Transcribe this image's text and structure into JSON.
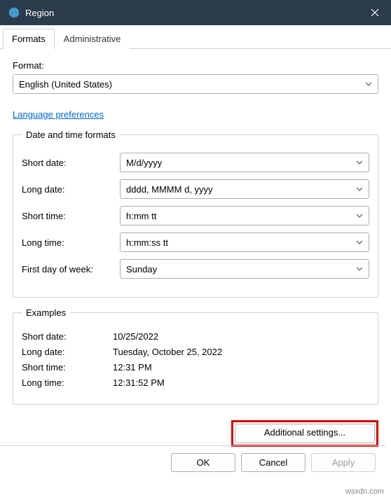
{
  "titlebar": {
    "title": "Region"
  },
  "tabs": {
    "formats": "Formats",
    "administrative": "Administrative"
  },
  "format": {
    "label": "Format:",
    "value": "English (United States)"
  },
  "link": {
    "language_prefs": "Language preferences"
  },
  "datetime_formats": {
    "legend": "Date and time formats",
    "short_date": {
      "label": "Short date:",
      "value": "M/d/yyyy"
    },
    "long_date": {
      "label": "Long date:",
      "value": "dddd, MMMM d, yyyy"
    },
    "short_time": {
      "label": "Short time:",
      "value": "h:mm tt"
    },
    "long_time": {
      "label": "Long time:",
      "value": "h:mm:ss tt"
    },
    "first_day": {
      "label": "First day of week:",
      "value": "Sunday"
    }
  },
  "examples": {
    "legend": "Examples",
    "short_date": {
      "label": "Short date:",
      "value": "10/25/2022"
    },
    "long_date": {
      "label": "Long date:",
      "value": "Tuesday, October 25, 2022"
    },
    "short_time": {
      "label": "Short time:",
      "value": "12:31 PM"
    },
    "long_time": {
      "label": "Long time:",
      "value": "12:31:52 PM"
    }
  },
  "buttons": {
    "additional": "Additional settings...",
    "ok": "OK",
    "cancel": "Cancel",
    "apply": "Apply"
  },
  "watermark": "wsxdn.com"
}
